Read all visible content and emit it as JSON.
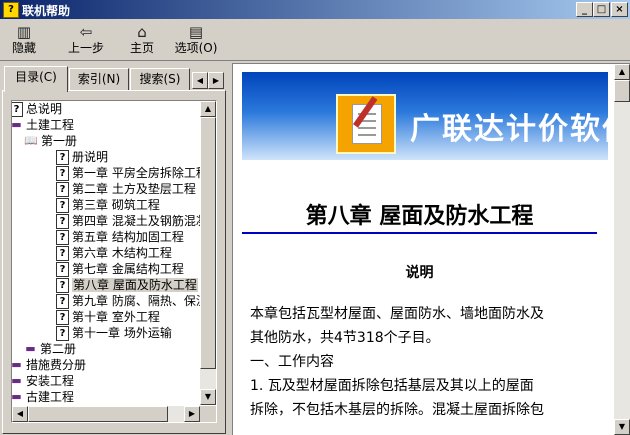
{
  "window": {
    "title": "联机帮助"
  },
  "toolbar": {
    "buttons": [
      {
        "label": "隐藏",
        "icon": "hide-icon"
      },
      {
        "label": "上一步",
        "icon": "back-arrow-icon"
      },
      {
        "label": "主页",
        "icon": "home-icon"
      },
      {
        "label": "选项(O)",
        "icon": "options-icon"
      }
    ]
  },
  "tabs": [
    {
      "label": "目录(C)"
    },
    {
      "label": "索引(N)"
    },
    {
      "label": "搜索(S)"
    }
  ],
  "tree": [
    {
      "label": "总说明",
      "icon": "help-page-icon",
      "level": 0
    },
    {
      "label": "土建工程",
      "icon": "book-icon",
      "level": 0
    },
    {
      "label": "第一册",
      "icon": "open-book-icon",
      "level": 1
    },
    {
      "label": "册说明",
      "icon": "help-page-icon",
      "level": 2
    },
    {
      "label": "第一章  平房全房拆除工程",
      "icon": "help-page-icon",
      "level": 2
    },
    {
      "label": "第二章  土方及垫层工程",
      "icon": "help-page-icon",
      "level": 2
    },
    {
      "label": "第三章  砌筑工程",
      "icon": "help-page-icon",
      "level": 2
    },
    {
      "label": "第四章  混凝土及钢筋混凝土",
      "icon": "help-page-icon",
      "level": 2
    },
    {
      "label": "第五章  结构加固工程",
      "icon": "help-page-icon",
      "level": 2
    },
    {
      "label": "第六章  木结构工程",
      "icon": "help-page-icon",
      "level": 2
    },
    {
      "label": "第七章  金属结构工程",
      "icon": "help-page-icon",
      "level": 2
    },
    {
      "label": "第八章  屋面及防水工程",
      "icon": "help-page-icon",
      "level": 2,
      "selected": true
    },
    {
      "label": "第九章  防腐、隔热、保温",
      "icon": "help-page-icon",
      "level": 2
    },
    {
      "label": "第十章  室外工程",
      "icon": "help-page-icon",
      "level": 2
    },
    {
      "label": "第十一章  场外运输",
      "icon": "help-page-icon",
      "level": 2
    },
    {
      "label": "第二册",
      "icon": "book-icon",
      "level": 1
    },
    {
      "label": "措施费分册",
      "icon": "book-icon",
      "level": 0
    },
    {
      "label": "安装工程",
      "icon": "book-icon",
      "level": 0
    },
    {
      "label": "古建工程",
      "icon": "book-icon",
      "level": 0
    }
  ],
  "content": {
    "banner_text": "广联达计价软件",
    "chapter_title": "第八章  屋面及防水工程",
    "section_title": "说明",
    "paragraphs": [
      "本章包括瓦型材屋面、屋面防水、墙地面防水及",
      "其他防水，共4节318个子目。",
      "一、工作内容",
      "1. 瓦及型材屋面拆除包括基层及其以上的屋面",
      "拆除，不包括木基层的拆除。混凝土屋面拆除包"
    ]
  },
  "colors": {
    "titlebar": "#0a246a",
    "rule": "#0000c0",
    "banner": "#2a78dc"
  }
}
